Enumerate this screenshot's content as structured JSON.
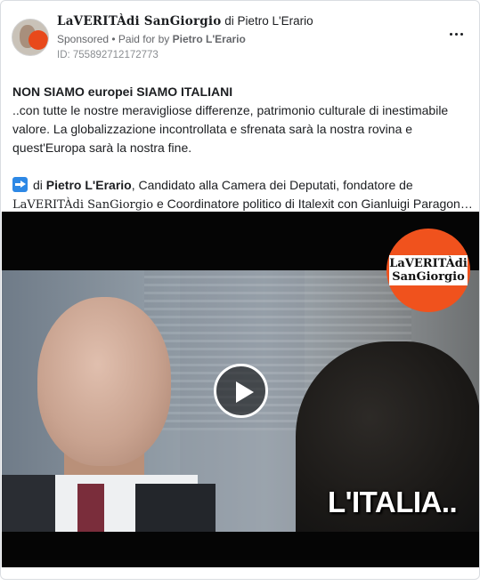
{
  "post": {
    "page_brand": "LaVERITÀdi SanGiorgio",
    "title_suffix": "di Pietro L'Erario",
    "sponsored_label": "Sponsored",
    "paid_for_prefix": "• Paid for by",
    "paid_for_name": "Pietro L'Erario",
    "ad_id": "ID: 755892712172773",
    "more_options_icon": "more-horizontal-icon"
  },
  "body": {
    "headline": "NON SIAMO europei SIAMO ITALIANI",
    "paragraph_1": "..con tutte le nostre meravigliose differenze, patrimonio culturale di inestimabile valore. La globalizzazione incontrollata e sfrenata sarà la nostra rovina e quest'Europa sarà la nostra fine.",
    "arrow_icon": "right-arrow-emoji-icon",
    "line2_prefix": "di",
    "line2_name": "Pietro L'Erario",
    "line2_suffix": ", Candidato alla Camera dei Deputati, fondatore de",
    "line3_brand": "LaVERITÀdi SanGiorgio",
    "line3_suffix": " e Coordinatore politico di Italexit con Gianluigi Paragon…"
  },
  "video": {
    "logo_line_1": "LaVERITÀdi",
    "logo_line_2": "SanGiorgio",
    "logo_color": "#f0521d",
    "caption": "L'ITALIA..",
    "play_icon": "play-icon"
  }
}
